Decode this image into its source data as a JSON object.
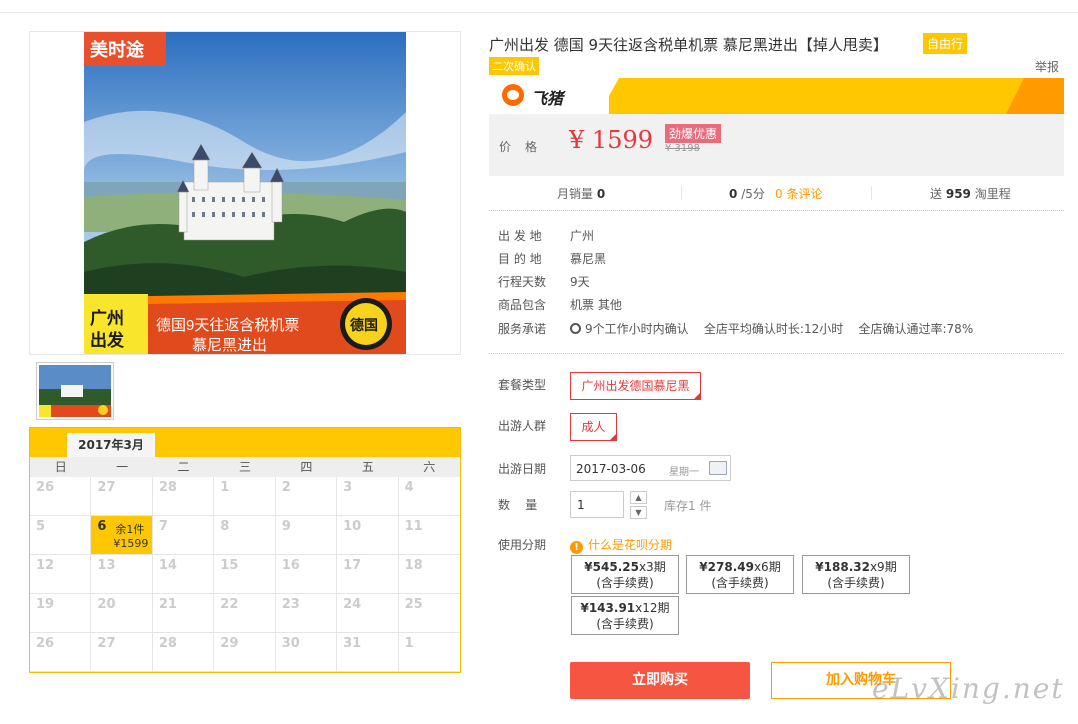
{
  "product": {
    "title": "广州出发 德国 9天往返含税单机票 慕尼黑进出【掉人甩卖】",
    "tag_free": "自由行",
    "tag_confirm": "二次确认",
    "report": "举报"
  },
  "images": {
    "logo_text": "美时途",
    "banner_left": "广州出发",
    "banner_center_line1": "德国9天往返含税机票",
    "banner_center_line2": "慕尼黑进出",
    "badge": "德国"
  },
  "brand": {
    "name": "飞猪",
    "bar_accent": "#ffc700"
  },
  "price": {
    "label": "价格",
    "currency": "¥",
    "current": "1599",
    "badge": "劲爆优惠",
    "original": "¥ 3198"
  },
  "stats": {
    "monthly_sales_label": "月销量",
    "monthly_sales": "0",
    "rating": "0",
    "rating_suffix": "/5分",
    "reviews": "0 条评论",
    "points_prefix": "送",
    "points": "959",
    "points_suffix": "淘里程"
  },
  "details": [
    {
      "label": "出 发 地",
      "value": "广州"
    },
    {
      "label": "目 的 地",
      "value": "慕尼黑"
    },
    {
      "label": "行程天数",
      "value": "9天"
    },
    {
      "label": "商品包含",
      "value": "机票  其他"
    }
  ],
  "service": {
    "label": "服务承诺",
    "item1": "9个工作小时内确认",
    "item2": "全店平均确认时长:12小时",
    "item3": "全店确认通过率:78%"
  },
  "form": {
    "package_label": "套餐类型",
    "package_value": "广州出发德国慕尼黑",
    "crowd_label": "出游人群",
    "crowd_value": "成人",
    "date_label": "出游日期",
    "date_value": "2017-03-06",
    "weekday": "星期一",
    "qty_label": "数    量",
    "qty_value": "1",
    "stock": "库存1 件",
    "installment_label": "使用分期",
    "installment_tip": "什么是花呗分期"
  },
  "plans": [
    {
      "amount": "¥545.25",
      "periods": "x3期",
      "fee": "(含手续费)"
    },
    {
      "amount": "¥278.49",
      "periods": "x6期",
      "fee": "(含手续费)"
    },
    {
      "amount": "¥188.32",
      "periods": "x9期",
      "fee": "(含手续费)"
    },
    {
      "amount": "¥143.91",
      "periods": "x12期",
      "fee": "(含手续费)"
    }
  ],
  "buttons": {
    "buy": "立即购买",
    "cart": "加入购物车"
  },
  "watermark": "eLvXing.net",
  "calendar": {
    "month": "2017年3月",
    "weekdays": [
      "日",
      "一",
      "二",
      "三",
      "四",
      "五",
      "六"
    ],
    "days": [
      "26",
      "27",
      "28",
      "1",
      "2",
      "3",
      "4",
      "5",
      "6",
      "7",
      "8",
      "9",
      "10",
      "11",
      "12",
      "13",
      "14",
      "15",
      "16",
      "17",
      "18",
      "19",
      "20",
      "21",
      "22",
      "23",
      "24",
      "25",
      "26",
      "27",
      "28",
      "29",
      "30",
      "31",
      "1"
    ],
    "active_day": "6",
    "active_stock": "余1件",
    "active_price": "¥1599"
  }
}
